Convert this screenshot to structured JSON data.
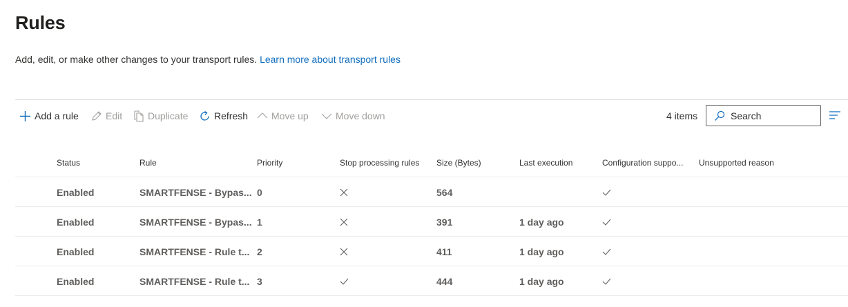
{
  "page": {
    "title": "Rules",
    "description": "Add, edit, or make other changes to your transport rules.",
    "learn_more_link": "Learn more about transport rules"
  },
  "toolbar": {
    "add_rule": "Add a rule",
    "edit": "Edit",
    "duplicate": "Duplicate",
    "refresh": "Refresh",
    "move_up": "Move up",
    "move_down": "Move down",
    "items_count": "4 items",
    "search_placeholder": "Search",
    "icons": {
      "add": "plus-icon",
      "edit": "pencil-icon",
      "duplicate": "copy-icon",
      "refresh": "refresh-icon",
      "move_up": "chevron-up-icon",
      "move_down": "chevron-down-icon",
      "search": "search-icon",
      "filter": "filter-lines-icon"
    }
  },
  "table": {
    "columns": [
      "Status",
      "Rule",
      "Priority",
      "Stop processing rules",
      "Size (Bytes)",
      "Last execution",
      "Configuration suppo...",
      "Unsupported reason"
    ],
    "rows": [
      {
        "status": "Enabled",
        "rule": "SMARTFENSE - Bypas...",
        "priority": "0",
        "stop_processing": "x-icon",
        "size": "564",
        "last_execution": "",
        "config_supported": "check-icon",
        "unsupported_reason": ""
      },
      {
        "status": "Enabled",
        "rule": "SMARTFENSE - Bypas...",
        "priority": "1",
        "stop_processing": "x-icon",
        "size": "391",
        "last_execution": "1 day ago",
        "config_supported": "check-icon",
        "unsupported_reason": ""
      },
      {
        "status": "Enabled",
        "rule": "SMARTFENSE - Rule t...",
        "priority": "2",
        "stop_processing": "x-icon",
        "size": "411",
        "last_execution": "1 day ago",
        "config_supported": "check-icon",
        "unsupported_reason": ""
      },
      {
        "status": "Enabled",
        "rule": "SMARTFENSE - Rule t...",
        "priority": "3",
        "stop_processing": "check-icon",
        "size": "444",
        "last_execution": "1 day ago",
        "config_supported": "check-icon",
        "unsupported_reason": ""
      }
    ]
  },
  "colors": {
    "link": "#0f6cbd",
    "text": "#323130",
    "muted": "#a19f9d",
    "border": "#edebe9"
  }
}
